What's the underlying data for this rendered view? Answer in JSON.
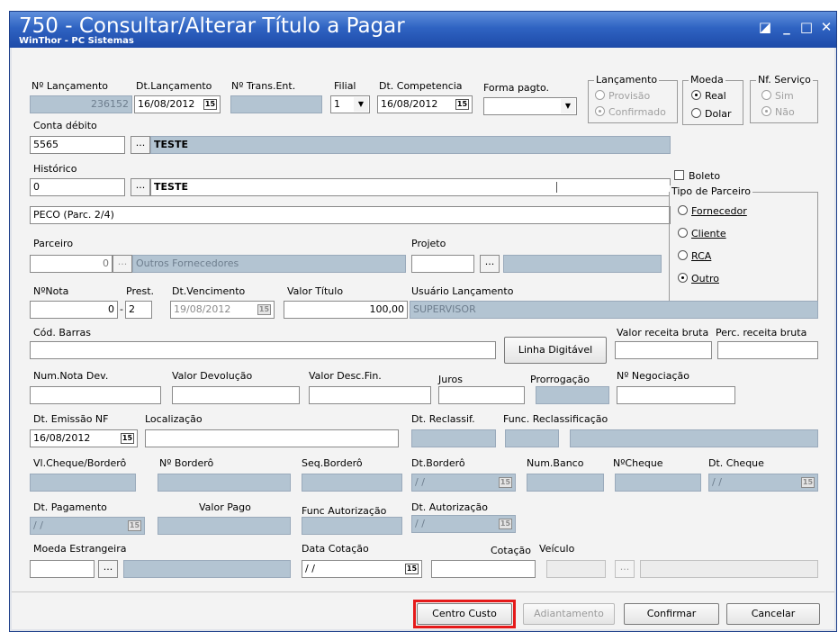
{
  "window": {
    "title": "750 - Consultar/Alterar Título a Pagar",
    "subtitle": "WinThor - PC Sistemas",
    "controls": {
      "restore": "◪",
      "minimize": "_",
      "maximize": "□",
      "close": "✕"
    }
  },
  "labels": {
    "num_lancamento": "Nº Lançamento",
    "dt_lancamento": "Dt.Lançamento",
    "num_trans_ent": "Nº Trans.Ent.",
    "filial": "Filial",
    "dt_competencia": "Dt. Competencia",
    "forma_pagto": "Forma pagto.",
    "conta_debito": "Conta débito",
    "historico": "Histórico",
    "parceiro": "Parceiro",
    "projeto": "Projeto",
    "num_nota": "NºNota",
    "prest": "Prest.",
    "dt_vencimento": "Dt.Vencimento",
    "valor_titulo": "Valor Título",
    "usuario_lancamento": "Usuário Lançamento",
    "cod_barras": "Cód. Barras",
    "valor_receita_bruta": "Valor receita bruta",
    "perc_receita_bruta": "Perc. receita bruta",
    "num_nota_dev": "Num.Nota Dev.",
    "valor_devolucao": "Valor Devolução",
    "valor_desc_fin": "Valor Desc.Fin.",
    "juros": "Juros",
    "prorrogacao": "Prorrogação",
    "num_negociacao": "Nº Negociação",
    "dt_emissao_nf": "Dt. Emissão NF",
    "localizacao": "Localização",
    "dt_reclassif": "Dt. Reclassif.",
    "func_reclassificacao": "Func. Reclassificação",
    "vl_cheque_bordero": "Vl.Cheque/Borderô",
    "num_bordero": "Nº Borderô",
    "seq_bordero": "Seq.Borderô",
    "dt_bordero": "Dt.Borderô",
    "num_banco": "Num.Banco",
    "num_cheque": "NºCheque",
    "dt_cheque": "Dt. Cheque",
    "dt_pagamento": "Dt. Pagamento",
    "valor_pago": "Valor Pago",
    "func_autorizacao": "Func Autorização",
    "dt_autorizacao": "Dt. Autorização",
    "moeda_estrangeira": "Moeda Estrangeira",
    "data_cotacao": "Data Cotação",
    "cotacao": "Cotação",
    "veiculo": "Veículo"
  },
  "values": {
    "num_lancamento": "236152",
    "dt_lancamento": "16/08/2012",
    "filial": "1",
    "dt_competencia": "16/08/2012",
    "conta_codigo": "5565",
    "conta_nome": "TESTE",
    "historico_codigo": "0",
    "historico_nome": "TESTE",
    "historico_texto": "PECO (Parc. 2/4)",
    "parceiro_codigo": "0",
    "parceiro_nome": "Outros Fornecedores",
    "num_nota": "0",
    "prest": "2",
    "dt_vencimento": "19/08/2012",
    "valor_titulo": "100,00",
    "usuario": "SUPERVISOR",
    "dt_emissao_nf": "16/08/2012",
    "empty_date": "/ /"
  },
  "groups": {
    "lancamento": {
      "title": "Lançamento",
      "options": [
        "Provisão",
        "Confirmado"
      ]
    },
    "moeda": {
      "title": "Moeda",
      "options": [
        "Real",
        "Dolar"
      ]
    },
    "nf_servico": {
      "title": "Nf. Serviço",
      "options": [
        "Sim",
        "Não"
      ]
    },
    "tipo_parceiro": {
      "title": "Tipo de Parceiro",
      "options": [
        "Fornecedor",
        "Cliente",
        "RCA",
        "Outro"
      ]
    }
  },
  "boleto_label": "Boleto",
  "icons": {
    "lookup": "...",
    "calendar": "15",
    "dropdown": "▼"
  },
  "buttons": {
    "linha_digitavel": "Linha Digitável",
    "centro_custo": "Centro Custo",
    "adiantamento": "Adiantamento",
    "confirmar": "Confirmar",
    "cancelar": "Cancelar"
  },
  "colors": {
    "title_bar": "#2f63c2",
    "readonly_field": "#b3c4d2",
    "highlight": "#e51a1a"
  }
}
